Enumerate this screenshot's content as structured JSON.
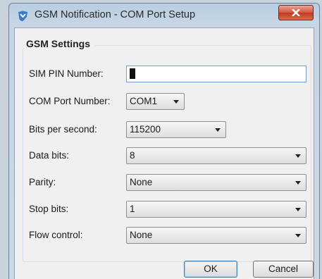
{
  "window": {
    "title": "GSM Notification - COM Port Setup"
  },
  "group": {
    "title": "GSM Settings"
  },
  "fields": {
    "sim_pin": {
      "label": "SIM PIN Number:",
      "value": ""
    },
    "com_port": {
      "label": "COM Port Number:",
      "value": "COM1"
    },
    "bits_per_second": {
      "label": "Bits per second:",
      "value": "115200"
    },
    "data_bits": {
      "label": "Data bits:",
      "value": "8"
    },
    "parity": {
      "label": "Parity:",
      "value": "None"
    },
    "stop_bits": {
      "label": "Stop bits:",
      "value": "1"
    },
    "flow_control": {
      "label": "Flow control:",
      "value": "None"
    }
  },
  "buttons": {
    "ok": "OK",
    "cancel": "Cancel"
  },
  "colors": {
    "close_button": "#c13a22",
    "focus_border": "#3c7fb1"
  }
}
